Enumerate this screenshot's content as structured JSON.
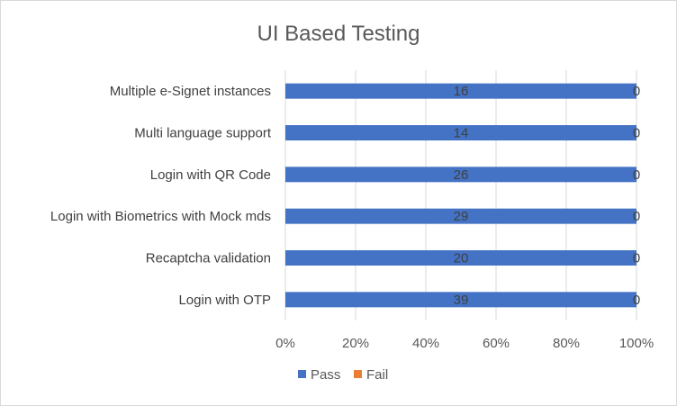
{
  "chart_data": {
    "type": "bar",
    "orientation": "horizontal",
    "stacking": "percent",
    "title": "UI Based Testing",
    "categories": [
      "Multiple e-Signet instances",
      "Multi language support",
      "Login with QR Code",
      "Login with Biometrics with Mock mds",
      "Recaptcha validation",
      "Login with OTP"
    ],
    "series": [
      {
        "name": "Pass",
        "color": "#4472c4",
        "values": [
          16,
          14,
          26,
          29,
          20,
          39
        ]
      },
      {
        "name": "Fail",
        "color": "#ed7d31",
        "values": [
          0,
          0,
          0,
          0,
          0,
          0
        ]
      }
    ],
    "data_labels": {
      "Pass": [
        "16",
        "14",
        "26",
        "29",
        "20",
        "39"
      ],
      "Fail": [
        "0",
        "0",
        "0",
        "0",
        "0",
        "0"
      ]
    },
    "x_ticks": [
      "0%",
      "20%",
      "40%",
      "60%",
      "80%",
      "100%"
    ],
    "xlim": [
      0,
      100
    ],
    "grid": true,
    "legend": "bottom"
  }
}
